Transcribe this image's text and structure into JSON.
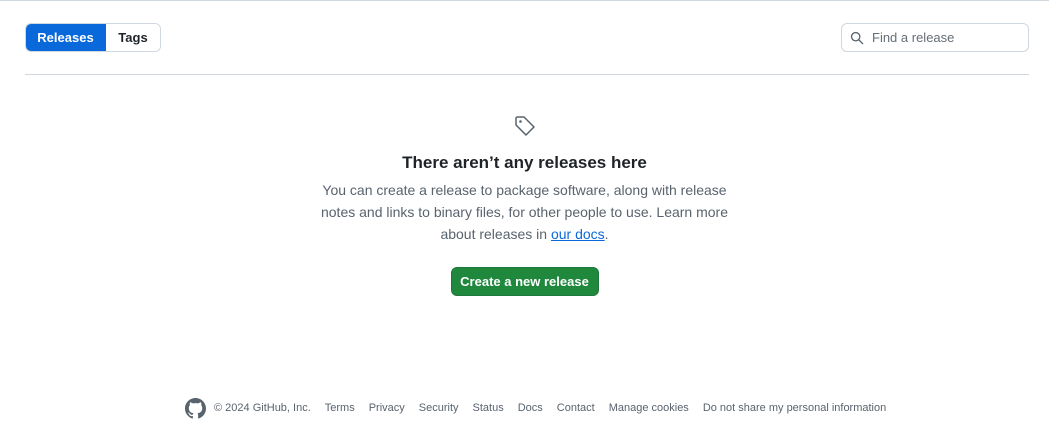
{
  "tabs": [
    {
      "label": "Releases",
      "active": true
    },
    {
      "label": "Tags",
      "active": false
    }
  ],
  "search": {
    "placeholder": "Find a release",
    "value": ""
  },
  "blankslate": {
    "icon": "tag-icon",
    "title": "There aren’t any releases here",
    "desc_before": "You can create a release to package software, along with release notes and links to binary files, for other people to use. Learn more about releases in ",
    "link_text": "our docs",
    "desc_after": ".",
    "button_label": "Create a new release"
  },
  "footer": {
    "logo": "github-logo",
    "copyright": "© 2024 GitHub, Inc.",
    "links": [
      "Terms",
      "Privacy",
      "Security",
      "Status",
      "Docs",
      "Contact",
      "Manage cookies",
      "Do not share my personal information"
    ]
  },
  "colors": {
    "primary_blue": "#0969da",
    "create_green": "#1f883d",
    "border": "#d0d7de",
    "muted_text": "#59636e"
  }
}
